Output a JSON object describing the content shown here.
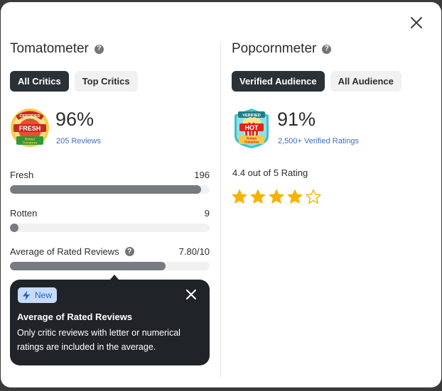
{
  "tomatometer": {
    "title": "Tomatometer",
    "help": "?",
    "tabs": [
      {
        "label": "All Critics",
        "active": true
      },
      {
        "label": "Top Critics",
        "active": false
      }
    ],
    "badge": {
      "lines": [
        "CERTIFIED",
        "FRESH",
        "Rotten",
        "Tomatoes"
      ]
    },
    "score": "96%",
    "reviews_link": "205 Reviews",
    "fresh": {
      "label": "Fresh",
      "value": "196",
      "fraction": 0.957
    },
    "rotten": {
      "label": "Rotten",
      "value": "9",
      "fraction": 0.044
    },
    "average": {
      "label": "Average of Rated Reviews",
      "value": "7.80/10",
      "fraction": 0.78
    }
  },
  "tooltip": {
    "badge": "New",
    "title": "Average of Rated Reviews",
    "body": "Only critic reviews with letter or numerical ratings are included in the average."
  },
  "popcornmeter": {
    "title": "Popcornmeter",
    "help": "?",
    "tabs": [
      {
        "label": "Verified Audience",
        "active": true
      },
      {
        "label": "All Audience",
        "active": false
      }
    ],
    "badge": {
      "lines": [
        "VERIFIED",
        "HOT",
        "Rotten",
        "Tomatoes"
      ]
    },
    "score": "91%",
    "ratings_link": "2,500+ Verified Ratings",
    "rating_text": "4.4 out of 5 Rating",
    "stars": {
      "filled": 4,
      "total": 5,
      "color": "#f5b301"
    }
  },
  "colors": {
    "accent_dark": "#2a3238",
    "link": "#3d6fc5",
    "bar_fill": "#757b80",
    "tooltip_bg": "#202428",
    "new_badge_bg": "#c7dbfa"
  }
}
